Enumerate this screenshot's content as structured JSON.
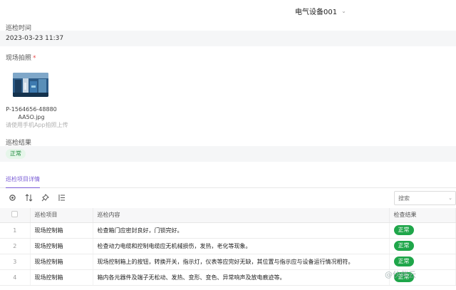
{
  "header": {
    "device_select": "电气设备001"
  },
  "fields": {
    "inspect_time_label": "巡检时间",
    "inspect_time_value": "2023-03-23 11:37",
    "photo_label": "现场拍照",
    "photo_required": "*",
    "photo_filename_line1": "P-1564656-48880",
    "photo_filename_line2": "AA5O.jpg",
    "upload_hint": "请使用手机App拍照上传",
    "result_label": "巡检结果",
    "result_value": "正常"
  },
  "tabs": [
    {
      "label": "巡检项目详情",
      "active": true
    }
  ],
  "toolbar": {
    "icons": [
      "settings-icon",
      "sort-icon",
      "pin-icon",
      "column-icon"
    ],
    "search_placeholder": "搜索"
  },
  "table": {
    "columns": [
      "",
      "巡检项目",
      "巡检内容",
      "检查结果"
    ],
    "rows": [
      {
        "idx": "1",
        "item": "现场控制箱",
        "content": "检查箱门应密封良好，门锁完好。",
        "result": "正常"
      },
      {
        "idx": "2",
        "item": "现场控制箱",
        "content": "检查动力电缆和控制电缆应无机械损伤，发热，老化等现象。",
        "result": "正常"
      },
      {
        "idx": "3",
        "item": "现场控制箱",
        "content": "现场控制箱上的按钮，转换开关，指示灯，仪表等应完好无缺，其位置与指示应与设备运行情况相符。",
        "result": "正常"
      },
      {
        "idx": "4",
        "item": "现场控制箱",
        "content": "箱内各元器件及端子无松动、发热、变形、变色、异常响声及放电痕迹等。",
        "result": "正常"
      }
    ]
  },
  "watermark": "@伙伴云",
  "colors": {
    "success": "#1fa64a",
    "accent": "#7a5cd6",
    "required": "#e84b4b"
  }
}
